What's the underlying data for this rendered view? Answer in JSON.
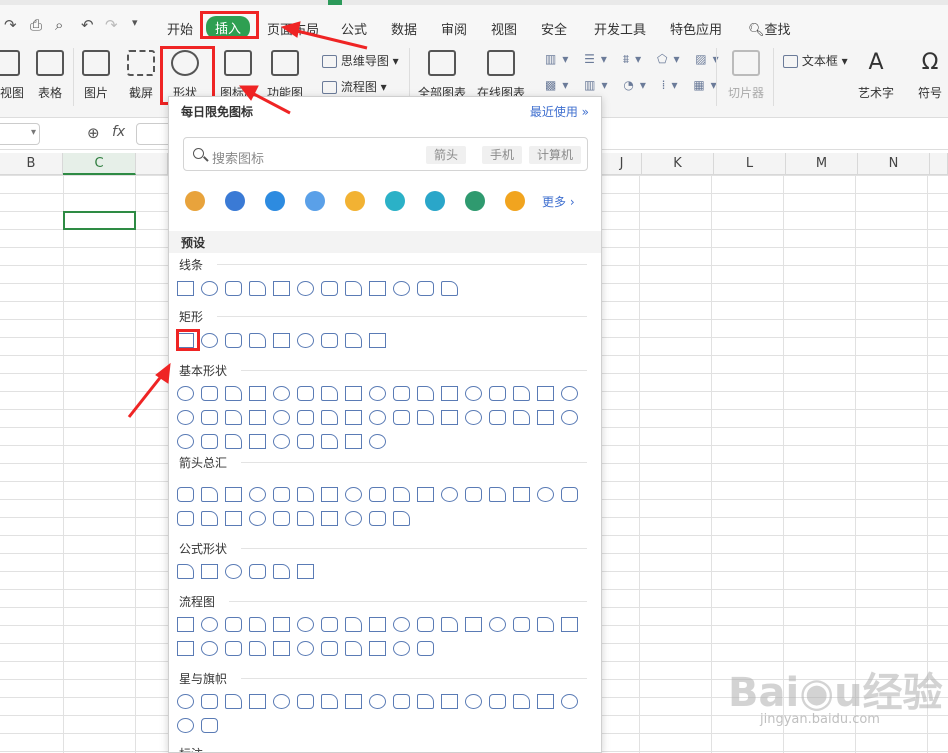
{
  "menu": {
    "items": [
      "开始",
      "插入",
      "页面布局",
      "公式",
      "数据",
      "审阅",
      "视图",
      "安全",
      "开发工具",
      "特色应用"
    ],
    "active": "插入",
    "search": "查找"
  },
  "ribbon": {
    "left_partial": [
      "系视图",
      "表格",
      "图片",
      "截屏",
      "形状",
      "图标库",
      "功能图"
    ],
    "mind_map": "思维导图",
    "flow_chart": "流程图",
    "all_charts": "全部图表",
    "online_charts": "在线图表",
    "slicer": "切片器",
    "text_box": "文本框",
    "art_text": "艺术字",
    "symbol": "符号"
  },
  "formula_bar": {
    "fx": "fx"
  },
  "columns": [
    "B",
    "C",
    "J",
    "K",
    "L",
    "M",
    "N"
  ],
  "panel": {
    "title": "每日限免图标",
    "recent": "最近使用",
    "search_placeholder": "搜索图标",
    "tags": [
      "箭头",
      "手机",
      "计算机"
    ],
    "more": "更多",
    "preset": "预设",
    "sections": [
      "线条",
      "矩形",
      "基本形状",
      "箭头总汇",
      "公式形状",
      "流程图",
      "星与旗帜",
      "标注"
    ],
    "icon_colors": [
      "#e8a33c",
      "#3a7ad5",
      "#2d8be0",
      "#5aa0e8",
      "#f2b233",
      "#2bb1c7",
      "#2aa6c9",
      "#2f9a6f",
      "#f1a41f"
    ]
  },
  "watermark": {
    "brand": "Baidu经验",
    "url": "jingyan.baidu.com"
  }
}
